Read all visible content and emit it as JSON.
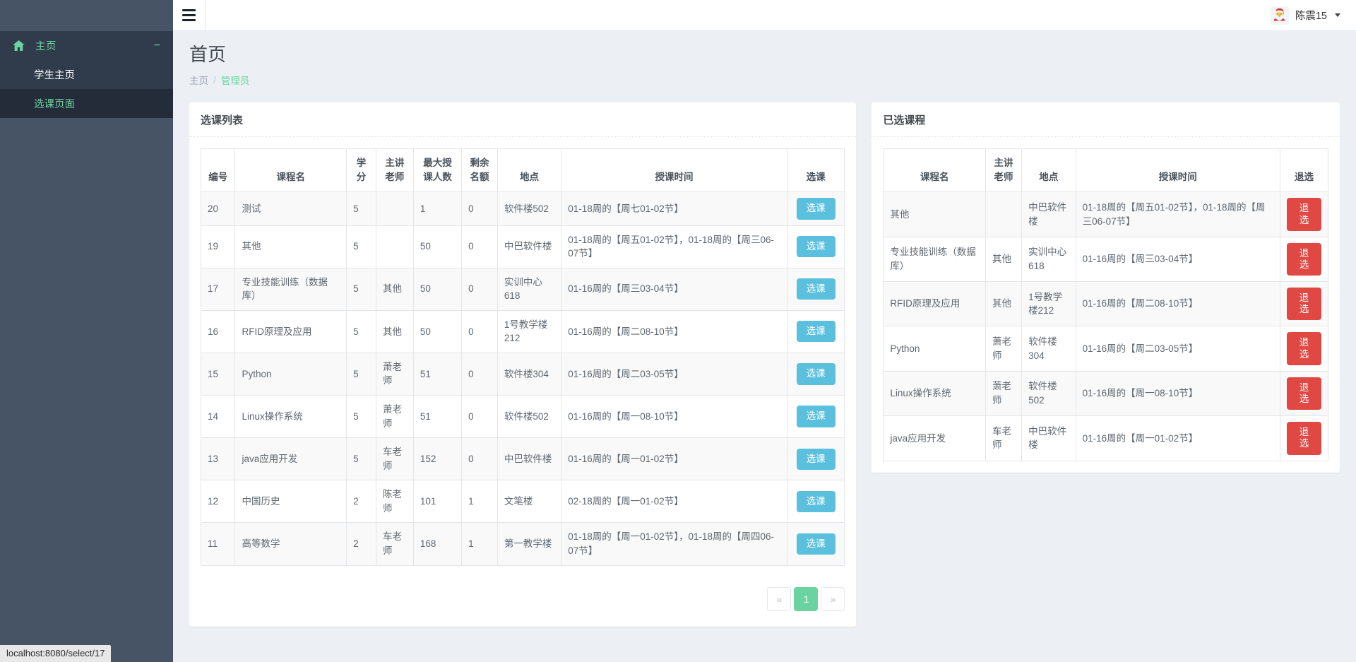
{
  "navbar": {
    "hamburger_icon": "hamburger-icon",
    "avatar_icon": "user-avatar",
    "user_name": "陈震15",
    "caret_icon": "chevron-down-icon"
  },
  "sidebar": {
    "parent": {
      "icon": "home-icon",
      "label": "主页",
      "toggle": "−"
    },
    "items": [
      {
        "label": "学生主页",
        "active": false
      },
      {
        "label": "选课页面",
        "active": true
      }
    ]
  },
  "page": {
    "title": "首页",
    "breadcrumb": {
      "home": "主页",
      "separator": "/",
      "current": "管理员"
    }
  },
  "course_list": {
    "card_title": "选课列表",
    "headers": [
      "编号",
      "课程名",
      "学分",
      "主讲老师",
      "最大授课人数",
      "剩余名额",
      "地点",
      "授课时间",
      "选课"
    ],
    "action_label": "选课",
    "rows": [
      {
        "id": "20",
        "name": "测试",
        "credit": "5",
        "teacher": "",
        "max": "1",
        "remain": "0",
        "place": "软件楼502",
        "time": "01-18周的【周七01-02节】"
      },
      {
        "id": "19",
        "name": "其他",
        "credit": "5",
        "teacher": "",
        "max": "50",
        "remain": "0",
        "place": "中巴软件楼",
        "time": "01-18周的【周五01-02节】，01-18周的【周三06-07节】"
      },
      {
        "id": "17",
        "name": "专业技能训练（数据库）",
        "credit": "5",
        "teacher": "其他",
        "max": "50",
        "remain": "0",
        "place": "实训中心618",
        "time": "01-16周的【周三03-04节】"
      },
      {
        "id": "16",
        "name": "RFID原理及应用",
        "credit": "5",
        "teacher": "其他",
        "max": "50",
        "remain": "0",
        "place": "1号教学楼212",
        "time": "01-16周的【周二08-10节】"
      },
      {
        "id": "15",
        "name": "Python",
        "credit": "5",
        "teacher": "萧老师",
        "max": "51",
        "remain": "0",
        "place": "软件楼304",
        "time": "01-16周的【周二03-05节】"
      },
      {
        "id": "14",
        "name": "Linux操作系统",
        "credit": "5",
        "teacher": "萧老师",
        "max": "51",
        "remain": "0",
        "place": "软件楼502",
        "time": "01-16周的【周一08-10节】"
      },
      {
        "id": "13",
        "name": "java应用开发",
        "credit": "5",
        "teacher": "车老师",
        "max": "152",
        "remain": "0",
        "place": "中巴软件楼",
        "time": "01-16周的【周一01-02节】"
      },
      {
        "id": "12",
        "name": "中国历史",
        "credit": "2",
        "teacher": "陈老师",
        "max": "101",
        "remain": "1",
        "place": "文笔楼",
        "time": "02-18周的【周一01-02节】"
      },
      {
        "id": "11",
        "name": "高等数学",
        "credit": "2",
        "teacher": "车老师",
        "max": "168",
        "remain": "1",
        "place": "第一教学楼",
        "time": "01-18周的【周一01-02节】，01-18周的【周四06-07节】"
      }
    ]
  },
  "pagination": {
    "prev": "«",
    "next": "»",
    "pages": [
      "1"
    ],
    "current": "1"
  },
  "selected_courses": {
    "card_title": "已选课程",
    "headers": [
      "课程名",
      "主讲老师",
      "地点",
      "授课时间",
      "退选"
    ],
    "action_label": "退选",
    "rows": [
      {
        "name": "其他",
        "teacher": "",
        "place": "中巴软件楼",
        "time": "01-18周的【周五01-02节】，01-18周的【周三06-07节】"
      },
      {
        "name": "专业技能训练（数据库）",
        "teacher": "其他",
        "place": "实训中心618",
        "time": "01-16周的【周三03-04节】"
      },
      {
        "name": "RFID原理及应用",
        "teacher": "其他",
        "place": "1号教学楼212",
        "time": "01-16周的【周二08-10节】"
      },
      {
        "name": "Python",
        "teacher": "萧老师",
        "place": "软件楼304",
        "time": "01-16周的【周二03-05节】"
      },
      {
        "name": "Linux操作系统",
        "teacher": "萧老师",
        "place": "软件楼502",
        "time": "01-16周的【周一08-10节】"
      },
      {
        "name": "java应用开发",
        "teacher": "车老师",
        "place": "中巴软件楼",
        "time": "01-16周的【周一01-02节】"
      }
    ]
  },
  "status_bar": {
    "url": "localhost:8080/select/17"
  },
  "colors": {
    "accent_green": "#6bd3a0",
    "sidebar_bg": "#303c4b",
    "sidebar_top": "#475466",
    "info_blue": "#5bc0de",
    "danger_red": "#e04844",
    "page_bg": "#ecf0f5"
  }
}
